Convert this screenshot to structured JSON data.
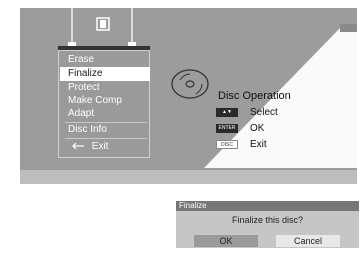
{
  "menu": {
    "items": [
      "Erase",
      "Finalize",
      "Protect",
      "Make Comp",
      "Adapt",
      "Disc Info"
    ],
    "selected": "Finalize",
    "exit_label": "Exit"
  },
  "disc_operation": {
    "title": "Disc Operation",
    "hints": [
      {
        "key": "▲▼",
        "label": "Select"
      },
      {
        "key": "ENTER",
        "label": "OK"
      },
      {
        "key": "DISC",
        "label": "Exit"
      }
    ]
  },
  "dialog": {
    "title": "Finalize",
    "message": "Finalize this disc?",
    "ok_label": "OK",
    "cancel_label": "Cancel"
  },
  "colors": {
    "screen_bg": "#9c9c9c",
    "selected_bg": "#ffffff",
    "dialog_bg": "#c6c6c6"
  }
}
